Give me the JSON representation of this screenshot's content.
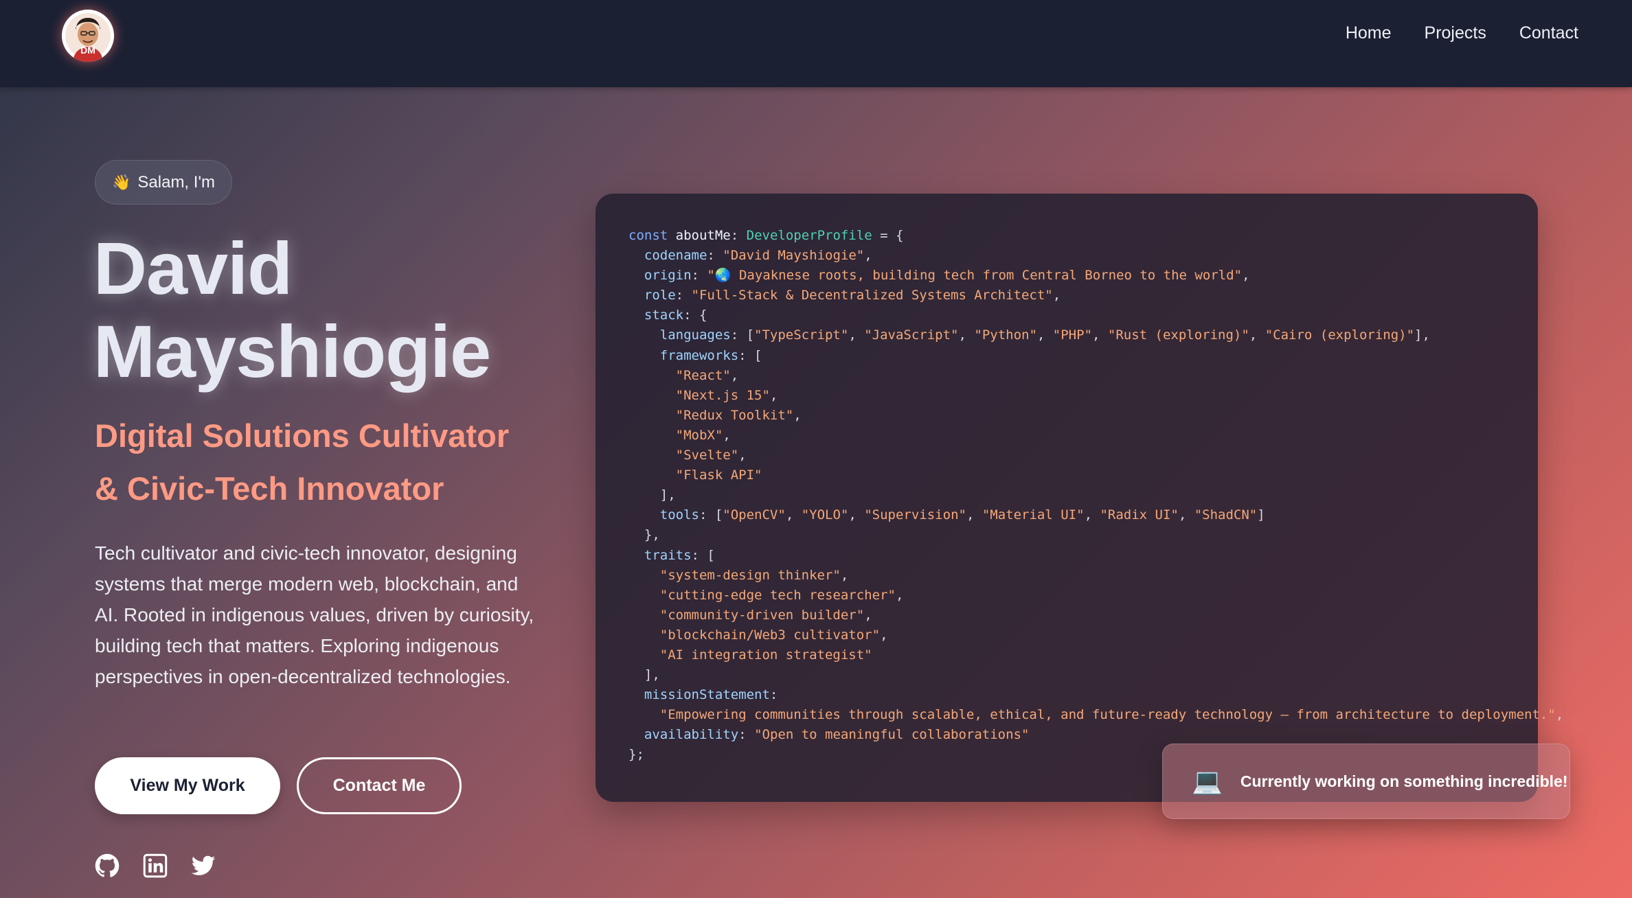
{
  "nav": {
    "logo_initials": "DM",
    "links": [
      "Home",
      "Projects",
      "Contact"
    ]
  },
  "hero": {
    "greeting_icon": "waving-hand-icon",
    "greeting": "Salam, I'm",
    "name_first": "David",
    "name_last": "Mayshiogie",
    "title_line1": "Digital Solutions Cultivator",
    "title_line2": "& Civic-Tech Innovator",
    "description": "Tech cultivator and civic-tech innovator, designing systems that merge modern web, blockchain, and AI. Rooted in indigenous values, driven by curiosity, building tech that matters. Exploring indigenous perspectives in open-decentralized technologies.",
    "primary_button": "View My Work",
    "secondary_button": "Contact Me",
    "socials": [
      "github-icon",
      "linkedin-icon",
      "twitter-icon"
    ]
  },
  "code": {
    "declaration": {
      "keyword": "const",
      "name": "aboutMe",
      "type": "DeveloperProfile"
    },
    "codename": "\"David Mayshiogie\"",
    "origin": "\"🌏 Dayaknese roots, building tech from Central Borneo to the world\"",
    "role": "\"Full-Stack & Decentralized Systems Architect\"",
    "languages": [
      "\"TypeScript\"",
      "\"JavaScript\"",
      "\"Python\"",
      "\"PHP\"",
      "\"Rust (exploring)\"",
      "\"Cairo (exploring)\""
    ],
    "frameworks": [
      "\"React\"",
      "\"Next.js 15\"",
      "\"Redux Toolkit\"",
      "\"MobX\"",
      "\"Svelte\"",
      "\"Flask API\""
    ],
    "tools": [
      "\"OpenCV\"",
      "\"YOLO\"",
      "\"Supervision\"",
      "\"Material UI\"",
      "\"Radix UI\"",
      "\"ShadCN\""
    ],
    "traits": [
      "\"system-design thinker\"",
      "\"cutting-edge tech researcher\"",
      "\"community-driven builder\"",
      "\"blockchain/Web3 cultivator\"",
      "\"AI integration strategist\""
    ],
    "missionStatement": "\"Empowering communities through scalable, ethical, and future-ready technology — from architecture to deployment.\"",
    "availability": "\"Open to meaningful collaborations\""
  },
  "toast": {
    "icon": "laptop-icon",
    "text": "Currently working on something incredible!"
  },
  "colors": {
    "navbar": "#1b2033",
    "accent": "#ff9a84",
    "code_string": "#f5a878",
    "code_key": "#9fd4ff",
    "code_type": "#4fd1b5",
    "code_keyword": "#7fb0ff"
  }
}
